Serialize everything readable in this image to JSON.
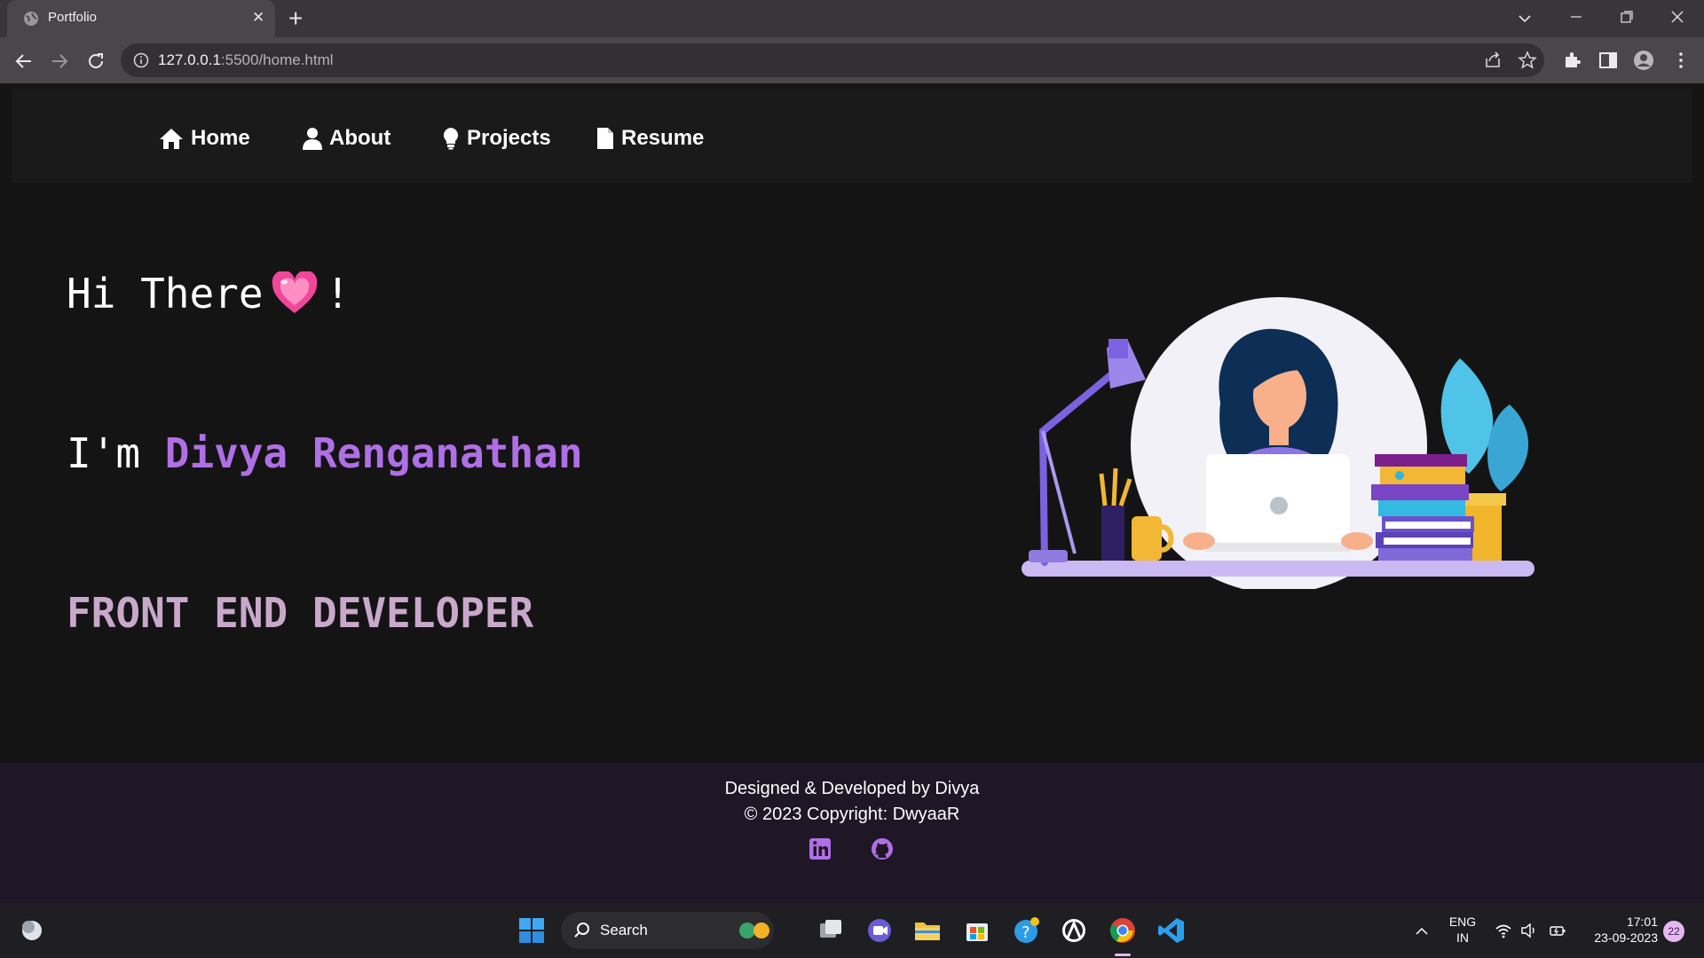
{
  "browser": {
    "tab_title": "Portfolio",
    "url_host": "127.0.0.1",
    "url_rest": ":5500/home.html"
  },
  "site_nav": {
    "items": [
      {
        "label": "Home",
        "icon": "home-icon"
      },
      {
        "label": "About",
        "icon": "user-icon"
      },
      {
        "label": "Projects",
        "icon": "lightbulb-icon"
      },
      {
        "label": "Resume",
        "icon": "file-icon"
      }
    ]
  },
  "hero": {
    "greeting": "Hi There",
    "greeting_emoji": "💗",
    "greeting_end": "!",
    "intro": "I'm ",
    "name": "Divya Renganathan",
    "role": "FRONT END DEVELOPER"
  },
  "footer": {
    "line1": "Designed & Developed by Divya",
    "line2": "© 2023 Copyright: DwyaaR",
    "social": [
      "linkedin-icon",
      "github-icon"
    ]
  },
  "taskbar": {
    "search_label": "Search",
    "lang": "ENG",
    "region": "IN",
    "time": "17:01",
    "date": "23-09-2023",
    "notifications": "22"
  },
  "colors": {
    "accent": "#b06fe6",
    "role": "#c9a8cc",
    "footer_bg": "#1f1726",
    "page_bg": "#151414"
  }
}
